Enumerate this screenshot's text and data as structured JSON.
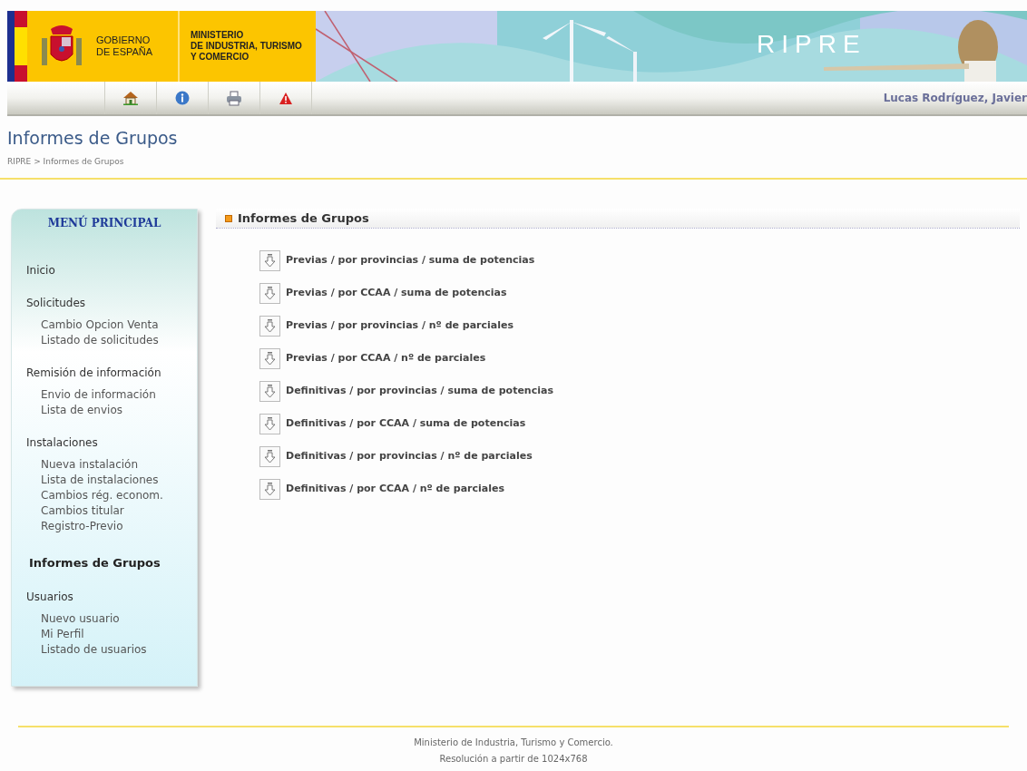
{
  "header": {
    "government": "GOBIERNO\nDE ESPAÑA",
    "ministry": "MINISTERIO\nDE INDUSTRIA, TURISMO\nY COMERCIO",
    "app_name": "RIPRE"
  },
  "toolbar": {
    "buttons": [
      {
        "kind": "home"
      },
      {
        "kind": "info"
      },
      {
        "kind": "print"
      },
      {
        "kind": "warning"
      }
    ],
    "user": "Lucas Rodríguez, Javier"
  },
  "page": {
    "title": "Informes de Grupos",
    "breadcrumb": "RIPRE > Informes de Grupos"
  },
  "menu": {
    "title": "MENÚ PRINCIPAL",
    "items": [
      {
        "label": "Inicio",
        "selected": false
      },
      {
        "label": "Solicitudes",
        "selected": false,
        "children": [
          {
            "label": "Cambio Opcion Venta",
            "selected": false
          },
          {
            "label": "Listado de solicitudes",
            "selected": false
          }
        ]
      },
      {
        "label": "Remisión de información",
        "selected": false,
        "children": [
          {
            "label": "Envio de información",
            "selected": false
          },
          {
            "label": "Lista de envios",
            "selected": false
          }
        ]
      },
      {
        "label": "Instalaciones",
        "selected": false,
        "children": [
          {
            "label": "Nueva instalación",
            "selected": false
          },
          {
            "label": "Lista de instalaciones",
            "selected": false
          },
          {
            "label": "Cambios rég. econom.",
            "selected": false
          },
          {
            "label": "Cambios titular",
            "selected": false
          },
          {
            "label": "Registro-Previo",
            "selected": false
          }
        ]
      },
      {
        "label": "Informes de Grupos",
        "selected": true
      },
      {
        "label": "Usuarios",
        "selected": false,
        "children": [
          {
            "label": "Nuevo usuario",
            "selected": false
          },
          {
            "label": "Mi Perfil",
            "selected": false
          },
          {
            "label": "Listado de usuarios",
            "selected": false
          }
        ]
      }
    ]
  },
  "content": {
    "heading": "Informes de Grupos",
    "reports": [
      "Previas / por provincias / suma de potencias",
      "Previas / por CCAA / suma de potencias",
      "Previas / por provincias / nº de parciales",
      "Previas / por CCAA / nº de parciales",
      "Definitivas / por provincias / suma de potencias",
      "Definitivas / por CCAA / suma de potencias",
      "Definitivas / por provincias / nº de parciales",
      "Definitivas / por CCAA / nº de parciales"
    ]
  },
  "footer": {
    "lines": [
      "Ministerio de Industria, Turismo y Comercio.",
      "Resolución a partir de 1024x768"
    ]
  }
}
